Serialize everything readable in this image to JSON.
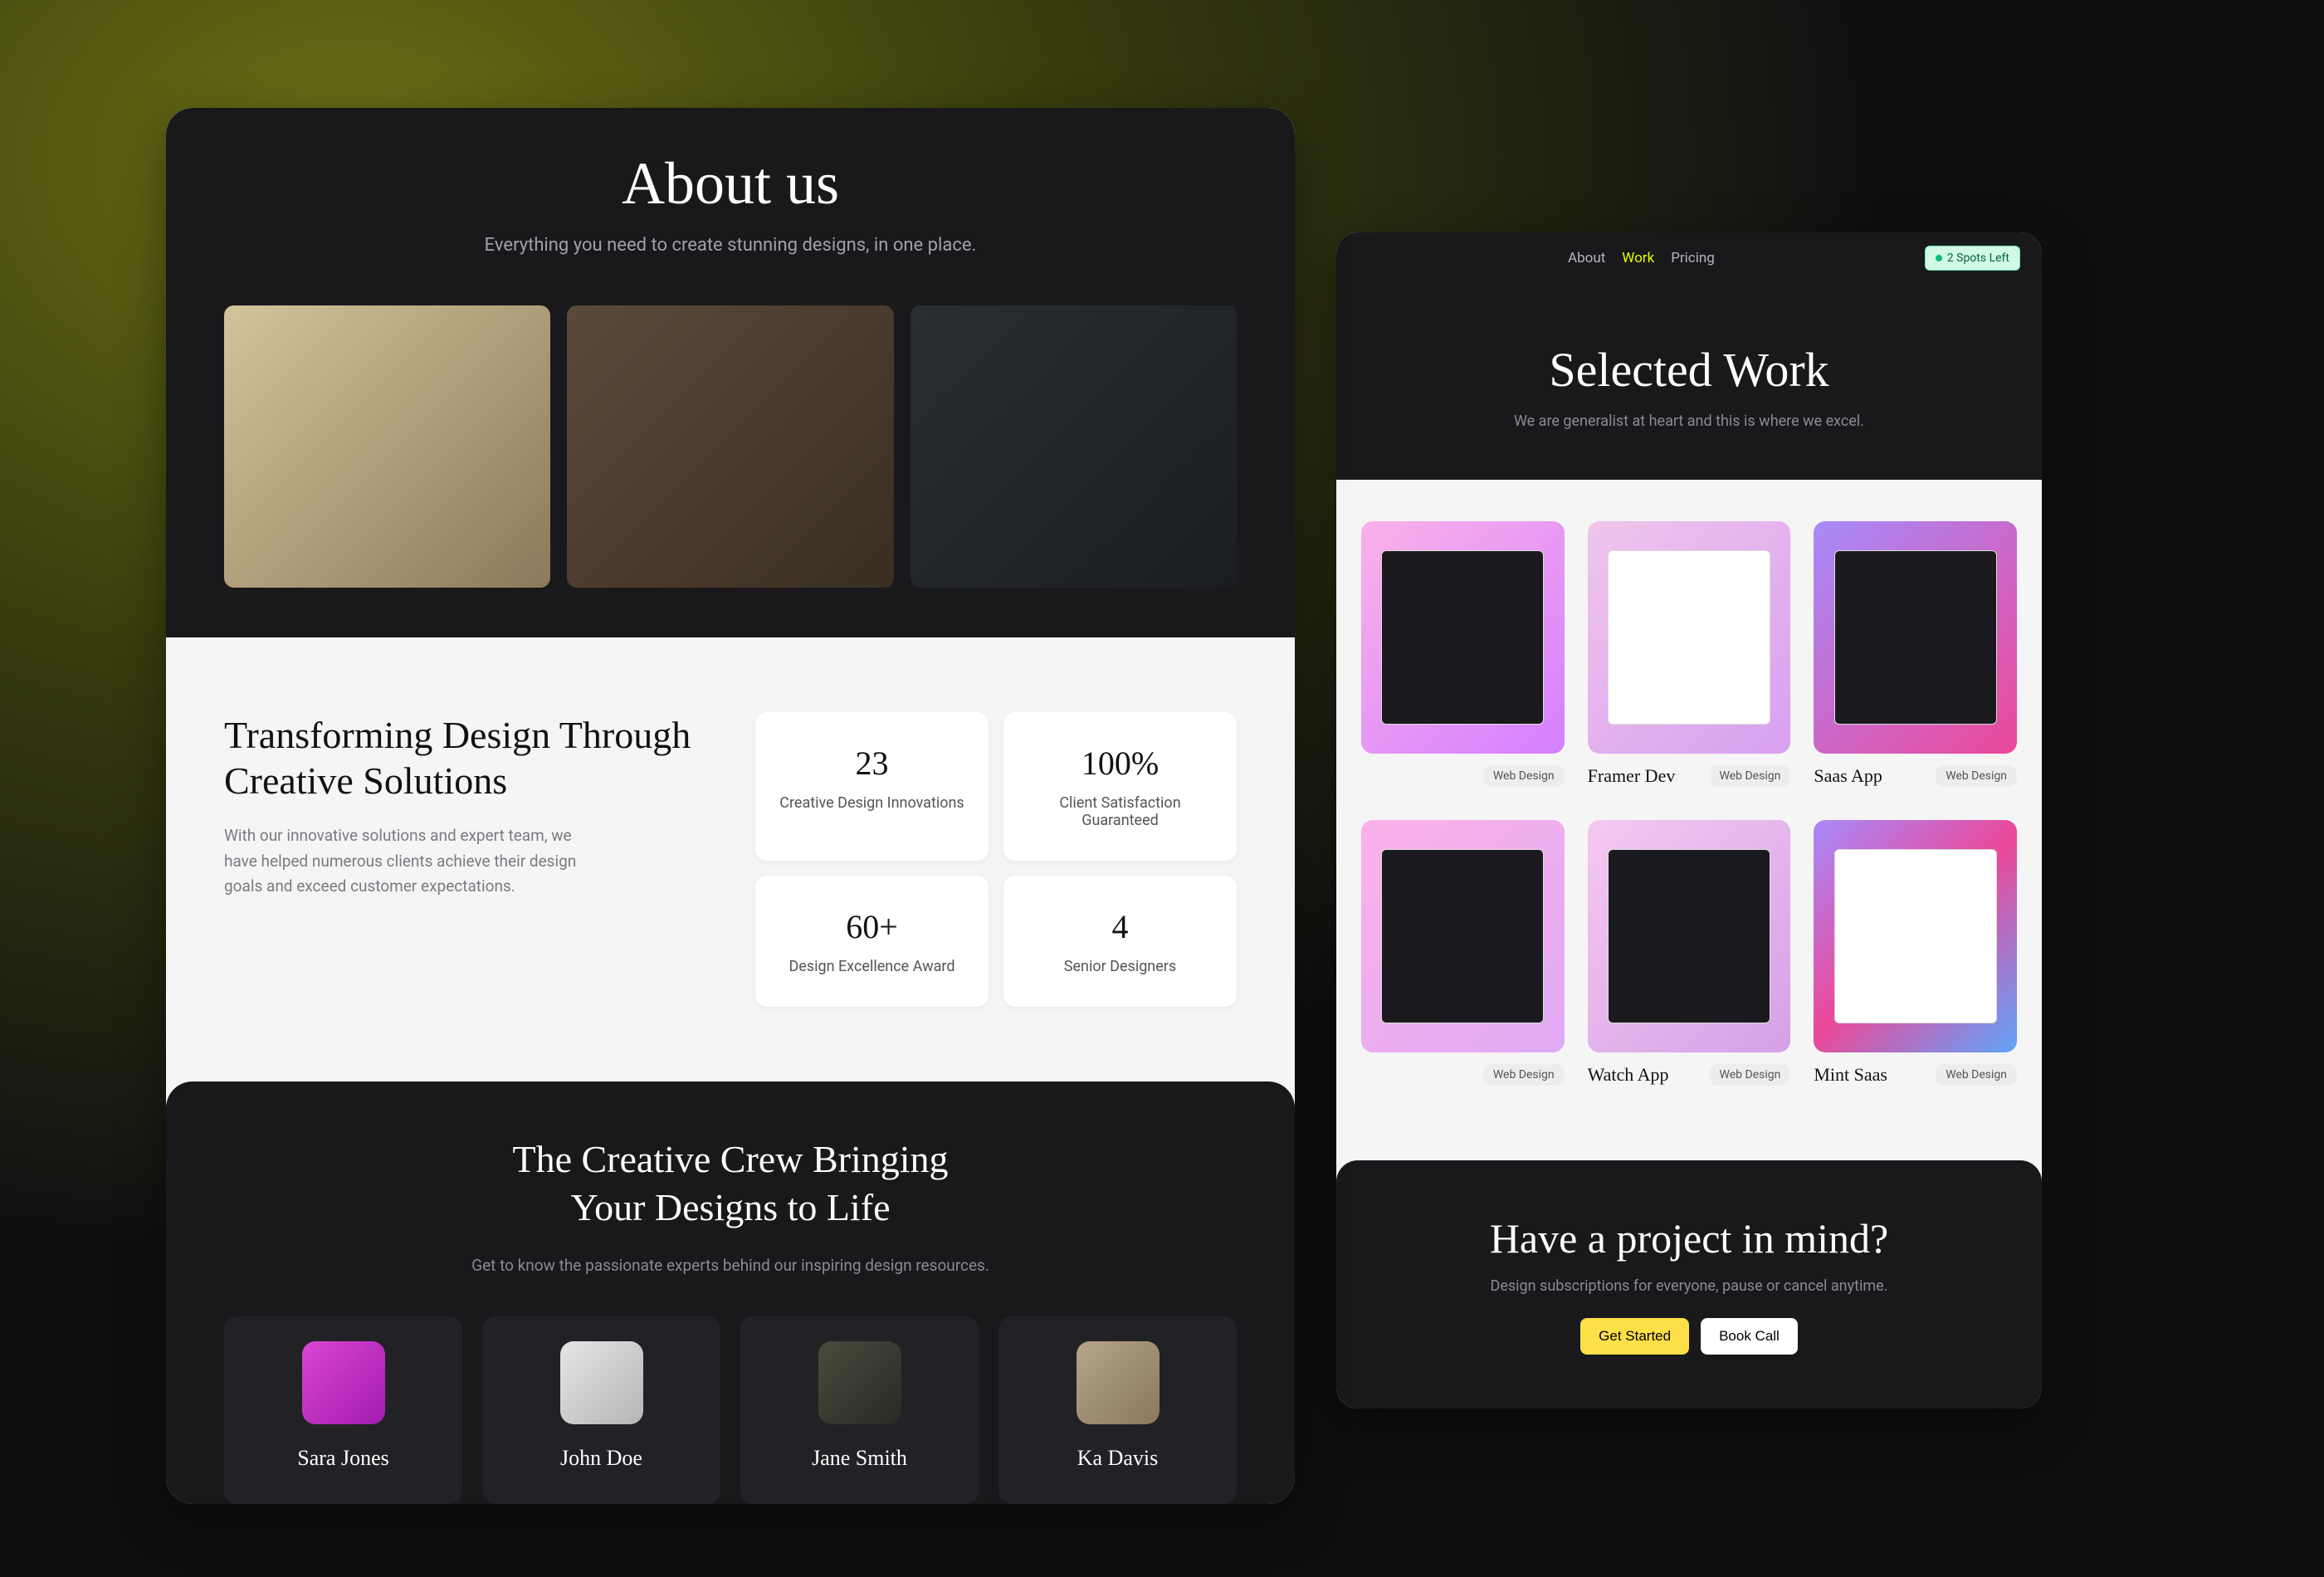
{
  "left": {
    "about": {
      "title": "About us",
      "subtitle": "Everything you need to create stunning designs, in one place."
    },
    "stats": {
      "heading": "Transforming Design Through Creative Solutions",
      "body": "With our innovative solutions and expert team, we have helped numerous clients achieve their design goals and exceed customer expectations.",
      "items": [
        {
          "num": "23",
          "label": "Creative Design Innovations"
        },
        {
          "num": "100%",
          "label": "Client Satisfaction Guaranteed"
        },
        {
          "num": "60+",
          "label": "Design Excellence Award"
        },
        {
          "num": "4",
          "label": "Senior Designers"
        }
      ]
    },
    "team": {
      "heading": "The Creative Crew Bringing Your Designs to Life",
      "subtitle": "Get to know the passionate experts behind our inspiring design resources.",
      "members": [
        {
          "name": "Sara Jones"
        },
        {
          "name": "John Doe"
        },
        {
          "name": "Jane Smith"
        },
        {
          "name": "Ka Davis"
        }
      ]
    }
  },
  "right": {
    "nav": {
      "about": "About",
      "work": "Work",
      "pricing": "Pricing",
      "spots": "2 Spots Left"
    },
    "work": {
      "title": "Selected Work",
      "subtitle": "We are generalist at heart and this is where we excel."
    },
    "portfolio": [
      {
        "title": "",
        "tag": "Web Design"
      },
      {
        "title": "Framer Dev",
        "tag": "Web Design"
      },
      {
        "title": "Saas App",
        "tag": "Web Design"
      },
      {
        "title": "",
        "tag": "Web Design"
      },
      {
        "title": "Watch App",
        "tag": "Web Design"
      },
      {
        "title": "Mint Saas",
        "tag": "Web Design"
      }
    ],
    "cta": {
      "title": "Have a project in mind?",
      "subtitle": "Design subscriptions for everyone, pause or cancel anytime.",
      "primary": "Get Started",
      "secondary": "Book Call"
    }
  }
}
